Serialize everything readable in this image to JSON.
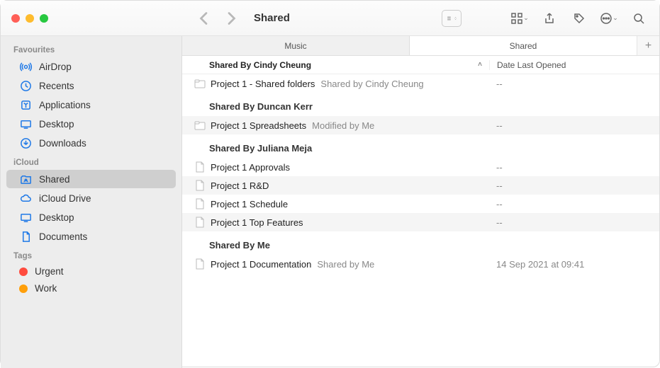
{
  "window": {
    "title": "Shared"
  },
  "toolbar": {},
  "tabs": [
    {
      "label": "Music",
      "active": false
    },
    {
      "label": "Shared",
      "active": true
    }
  ],
  "columns": {
    "c1": "Shared By Cindy Cheung",
    "c2": "Date Last Opened"
  },
  "sidebar": {
    "favourites_label": "Favourites",
    "icloud_label": "iCloud",
    "tags_label": "Tags",
    "favourites": [
      {
        "label": "AirDrop"
      },
      {
        "label": "Recents"
      },
      {
        "label": "Applications"
      },
      {
        "label": "Desktop"
      },
      {
        "label": "Downloads"
      }
    ],
    "icloud": [
      {
        "label": "Shared",
        "selected": true
      },
      {
        "label": "iCloud Drive"
      },
      {
        "label": "Desktop"
      },
      {
        "label": "Documents"
      }
    ],
    "tags": [
      {
        "label": "Urgent",
        "color": "#ff4b3e"
      },
      {
        "label": "Work",
        "color": "#ff9f0a"
      }
    ]
  },
  "groups": [
    {
      "header": "",
      "rows": [
        {
          "name": "Project 1 - Shared folders",
          "sub": "Shared by Cindy Cheung",
          "date": "--",
          "icon": "folder",
          "alt": false
        }
      ]
    },
    {
      "header": "Shared By Duncan Kerr",
      "rows": [
        {
          "name": "Project 1 Spreadsheets",
          "sub": "Modified by Me",
          "date": "--",
          "icon": "folder",
          "alt": true
        }
      ]
    },
    {
      "header": "Shared By Juliana Meja",
      "rows": [
        {
          "name": "Project 1 Approvals",
          "sub": "",
          "date": "--",
          "icon": "doc",
          "alt": false
        },
        {
          "name": "Project 1 R&D",
          "sub": "",
          "date": "--",
          "icon": "doc",
          "alt": true
        },
        {
          "name": "Project 1 Schedule",
          "sub": "",
          "date": "--",
          "icon": "doc",
          "alt": false
        },
        {
          "name": "Project 1 Top Features",
          "sub": "",
          "date": "--",
          "icon": "doc",
          "alt": true
        }
      ]
    },
    {
      "header": "Shared By Me",
      "rows": [
        {
          "name": "Project 1 Documentation",
          "sub": "Shared by Me",
          "date": "14 Sep 2021 at 09:41",
          "icon": "doc",
          "alt": false
        }
      ]
    }
  ]
}
